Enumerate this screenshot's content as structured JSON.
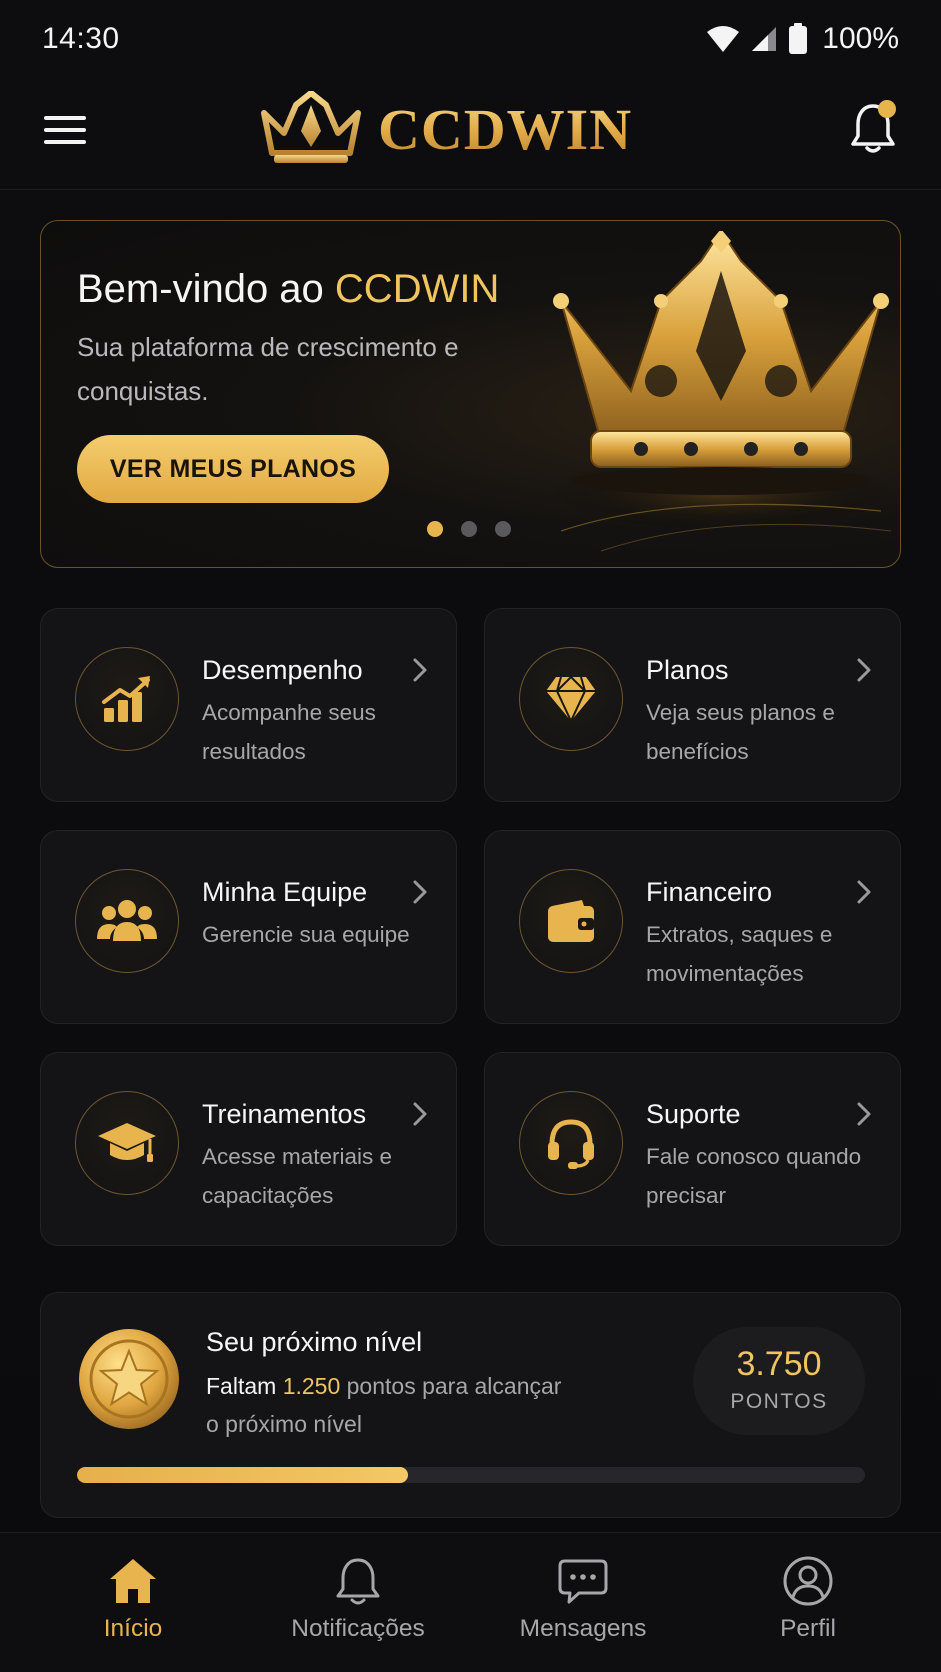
{
  "status_bar": {
    "time": "14:30",
    "battery": "100%"
  },
  "header": {
    "brand": "CCDWIN",
    "accent_color": "#e8b44e"
  },
  "hero": {
    "title_prefix": "Bem-vindo ao ",
    "title_brand": "CCDWIN",
    "subtitle": "Sua plataforma de crescimento e conquistas.",
    "cta_label": "VER MEUS PLANOS",
    "carousel_count": 3,
    "carousel_active": 1
  },
  "cards": [
    {
      "title": "Desempenho",
      "desc": "Acompanhe seus resultados",
      "icon": "chart-growth-icon"
    },
    {
      "title": "Planos",
      "desc": "Veja seus planos e benefícios",
      "icon": "diamond-icon"
    },
    {
      "title": "Minha Equipe",
      "desc": "Gerencie sua equipe",
      "icon": "team-icon"
    },
    {
      "title": "Financeiro",
      "desc": "Extratos, saques e movimentações",
      "icon": "wallet-icon"
    },
    {
      "title": "Treinamentos",
      "desc": "Acesse materiais e capacitações",
      "icon": "graduation-cap-icon"
    },
    {
      "title": "Suporte",
      "desc": "Fale conosco quando precisar",
      "icon": "headset-icon"
    }
  ],
  "level": {
    "title": "Seu próximo nível",
    "line_prefix": "Faltam",
    "points_missing": "1.250",
    "line_suffix": "pontos para alcançar",
    "line2": "o próximo nível",
    "points_value": "3.750",
    "points_label": "PONTOS",
    "progress_fraction": 0.42
  },
  "bottom_nav": [
    {
      "label": "Início",
      "icon": "home-icon",
      "active": true
    },
    {
      "label": "Notificações",
      "icon": "bell-icon",
      "active": false
    },
    {
      "label": "Mensagens",
      "icon": "chat-icon",
      "active": false
    },
    {
      "label": "Perfil",
      "icon": "profile-icon",
      "active": false
    }
  ]
}
